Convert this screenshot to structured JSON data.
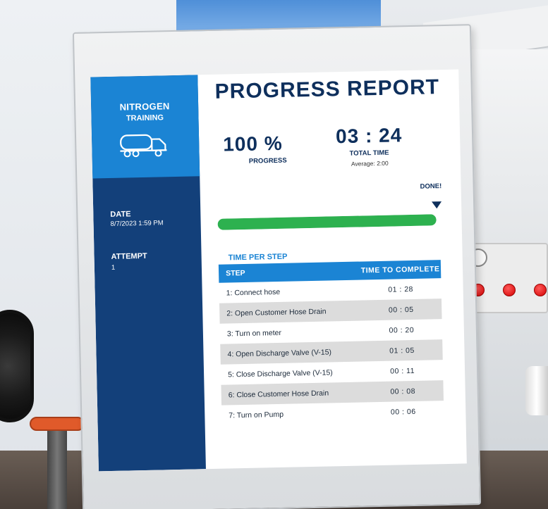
{
  "sidebar": {
    "brand_title": "NITROGEN",
    "brand_subtitle": "TRAINING",
    "brand_icon": "tanker-truck-icon",
    "date_label": "DATE",
    "date_value": "8/7/2023 1:59 PM",
    "attempt_label": "ATTEMPT",
    "attempt_value": "1"
  },
  "report": {
    "title": "PROGRESS REPORT",
    "progress_value": "100 %",
    "progress_label": "PROGRESS",
    "progress_fraction": 1.0,
    "time_value": "03 : 24",
    "time_label": "TOTAL TIME",
    "time_average": "Average: 2:00",
    "done_label": "DONE!"
  },
  "steps": {
    "heading": "TIME PER STEP",
    "col_step": "STEP",
    "col_time": "TIME TO COMPLETE",
    "rows": [
      {
        "step": "1: Connect hose",
        "time": "01 : 28"
      },
      {
        "step": "2: Open Customer Hose Drain",
        "time": "00 : 05"
      },
      {
        "step": "3: Turn on meter",
        "time": "00 : 20"
      },
      {
        "step": "4: Open Discharge Valve (V-15)",
        "time": "01 : 05"
      },
      {
        "step": "5: Close Discharge Valve (V-15)",
        "time": "00 : 11"
      },
      {
        "step": "6: Close Customer Hose Drain",
        "time": "00 : 08"
      },
      {
        "step": "7: Turn on Pump",
        "time": "00 : 06"
      }
    ]
  },
  "colors": {
    "sidebar_dark": "#13407a",
    "sidebar_light": "#1b84d4",
    "title_navy": "#0e2f5c",
    "progress_green": "#2db14f",
    "alt_row_gray": "#dcdcdc"
  }
}
